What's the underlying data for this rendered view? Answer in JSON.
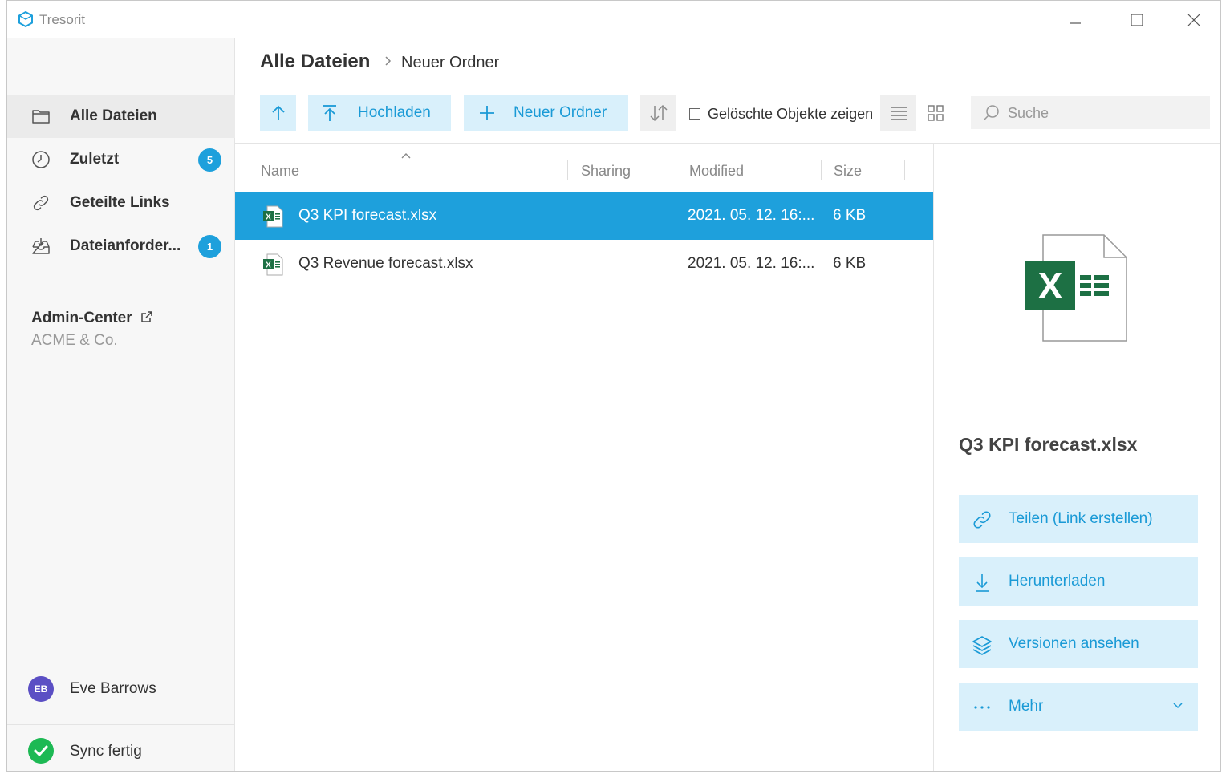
{
  "window": {
    "title": "Tresorit"
  },
  "sidebar": {
    "items": [
      {
        "label": "Alle Dateien",
        "icon": "folder-icon",
        "active": true
      },
      {
        "label": "Zuletzt",
        "icon": "clock-icon",
        "badge": "5"
      },
      {
        "label": "Geteilte Links",
        "icon": "link-icon"
      },
      {
        "label": "Dateianforder...",
        "icon": "inbox-icon",
        "badge": "1"
      }
    ],
    "admin": {
      "title": "Admin-Center",
      "org": "ACME & Co."
    },
    "user": {
      "initials": "EB",
      "name": "Eve Barrows"
    },
    "sync": {
      "label": "Sync fertig"
    }
  },
  "breadcrumb": {
    "root": "Alle Dateien",
    "current": "Neuer Ordner"
  },
  "toolbar": {
    "upload_label": "Hochladen",
    "new_folder_label": "Neuer Ordner",
    "show_deleted_label": "Gelöschte Objekte zeigen",
    "search_placeholder": "Suche"
  },
  "columns": {
    "name": "Name",
    "sharing": "Sharing",
    "modified": "Modified",
    "size": "Size"
  },
  "files": [
    {
      "name": "Q3 KPI forecast.xlsx",
      "modified": "2021. 05. 12. 16:...",
      "size": "6 KB",
      "selected": true
    },
    {
      "name": "Q3 Revenue forecast.xlsx",
      "modified": "2021. 05. 12. 16:...",
      "size": "6 KB",
      "selected": false
    }
  ],
  "details": {
    "title": "Q3 KPI forecast.xlsx",
    "actions": {
      "share": "Teilen (Link erstellen)",
      "download": "Herunterladen",
      "versions": "Versionen ansehen",
      "more": "Mehr"
    }
  },
  "colors": {
    "accent": "#1ea0dc",
    "accent_light": "#d9f0fb",
    "accent_text": "#1a9ad6",
    "excel_green": "#1d7044",
    "sync_green": "#1db954",
    "avatar": "#5b4fc4"
  }
}
